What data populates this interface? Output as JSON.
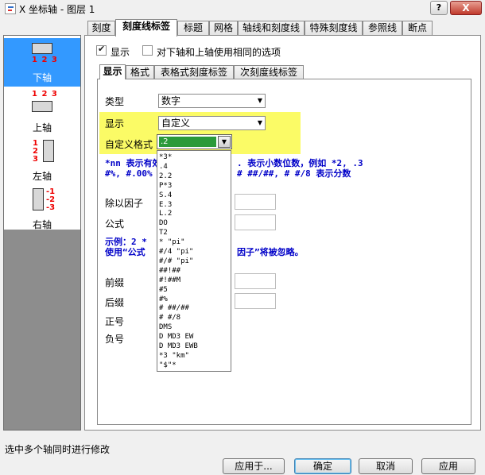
{
  "window": {
    "title": "X 坐标轴 - 图层 1",
    "help_label": "?",
    "close_label": "X"
  },
  "axes": [
    {
      "label": "下轴",
      "selected": true
    },
    {
      "label": "上轴",
      "selected": false
    },
    {
      "label": "左轴",
      "selected": false
    },
    {
      "label": "右轴",
      "selected": false
    }
  ],
  "axis_icon_ticks": {
    "h": "1 2 3",
    "v1": "1",
    "v2": "2",
    "v3": "3",
    "vneg1": "-1",
    "vneg2": "-2",
    "vneg3": "-3"
  },
  "tabs": [
    "刻度",
    "刻度线标签",
    "标题",
    "网格",
    "轴线和刻度线",
    "特殊刻度线",
    "参照线",
    "断点"
  ],
  "active_tab": "刻度线标签",
  "show_checkbox": {
    "label": "显示",
    "checked": true
  },
  "same_options_checkbox": {
    "label": "对下轴和上轴使用相同的选项",
    "checked": false
  },
  "inner_tabs": [
    "显示",
    "格式",
    "表格式刻度标签",
    "次刻度线标签"
  ],
  "active_inner_tab": "显示",
  "form": {
    "type_label": "类型",
    "type_value": "数字",
    "display_label": "显示",
    "display_value": "自定义",
    "custom_format_label": "自定义格式",
    "custom_format_value": ".2",
    "hint_line1": "*nn 表示有效",
    "hint_line1b": ". 表示小数位数，例如 *2, .3",
    "hint_line2": "#%, #.00%",
    "hint_line2b": "# ##/##, # #/8 表示分数",
    "divide_label": "除以因子",
    "formula_label": "公式",
    "example_line1": "示例：2 *",
    "example_line2": "使用“公式",
    "example_line2b": "因子”将被忽略。",
    "prefix_label": "前缀",
    "suffix_label": "后缀",
    "plus_label": "正号",
    "minus_label": "负号"
  },
  "dropdown_items": [
    "*3*",
    ".4",
    "2.2",
    "P*3",
    "S.4",
    "E.3",
    "L.2",
    "DO",
    "T2",
    "* \"pi\"",
    "#/4 \"pi\"",
    "#/# \"pi\"",
    "##!##",
    "#!##M",
    "#5",
    "#%",
    "# ##/##",
    "# #/8",
    "DMS",
    "D MD3 EW",
    "D MD3 EWB",
    "*3 \"km\"",
    "\"$\"*"
  ],
  "status_text": "选中多个轴同时进行修改",
  "buttons": {
    "apply_to": "应用于...",
    "ok": "确定",
    "cancel": "取消",
    "apply": "应用"
  },
  "colors": {
    "selection": "#3399ff",
    "highlight": "#fbfb66",
    "hint_blue": "#0000c8",
    "combo_selected": "#2b9a3a",
    "close": "#c0392b"
  }
}
